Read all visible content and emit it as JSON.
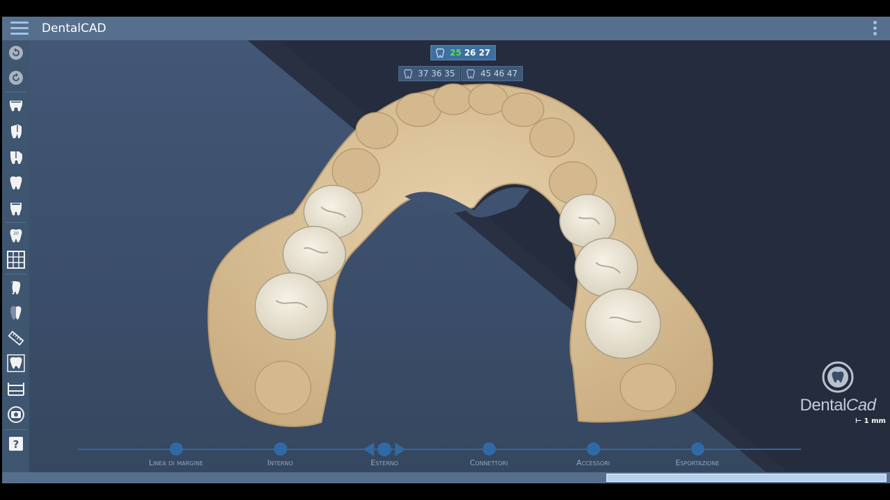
{
  "app": {
    "title": "DentalCAD"
  },
  "tooth_tags": [
    {
      "green": "25",
      "white": "26 27"
    },
    {
      "text": "37 36 35"
    },
    {
      "text": "45 46 47"
    }
  ],
  "brand": {
    "name_regular": "Dental",
    "name_italic": "Cad"
  },
  "scale": {
    "label": "1 mm"
  },
  "steps": [
    {
      "label": "Linea di margine"
    },
    {
      "label": "Interno"
    },
    {
      "label": "Esterno"
    },
    {
      "label": "Connettori"
    },
    {
      "label": "Accessori"
    },
    {
      "label": "Esportazione"
    }
  ],
  "sidebar_icons": [
    "undo-icon",
    "redo-icon",
    "crown-icon",
    "tooth-side-icon",
    "tooth-cut-icon",
    "tooth-full-icon",
    "tooth-shell-icon",
    "tooth-number-icon",
    "grid-icon",
    "tooth-profile-icon",
    "tooth-half-icon",
    "ruler-icon",
    "tooth-box-icon",
    "section-icon",
    "camera-icon",
    "help-icon"
  ],
  "colors": {
    "titlebar": "#566f8d",
    "sidebar": "#3f5670",
    "accent": "#2f6aa5",
    "model": "#dcc5a0",
    "teeth": "#ece6d6"
  }
}
